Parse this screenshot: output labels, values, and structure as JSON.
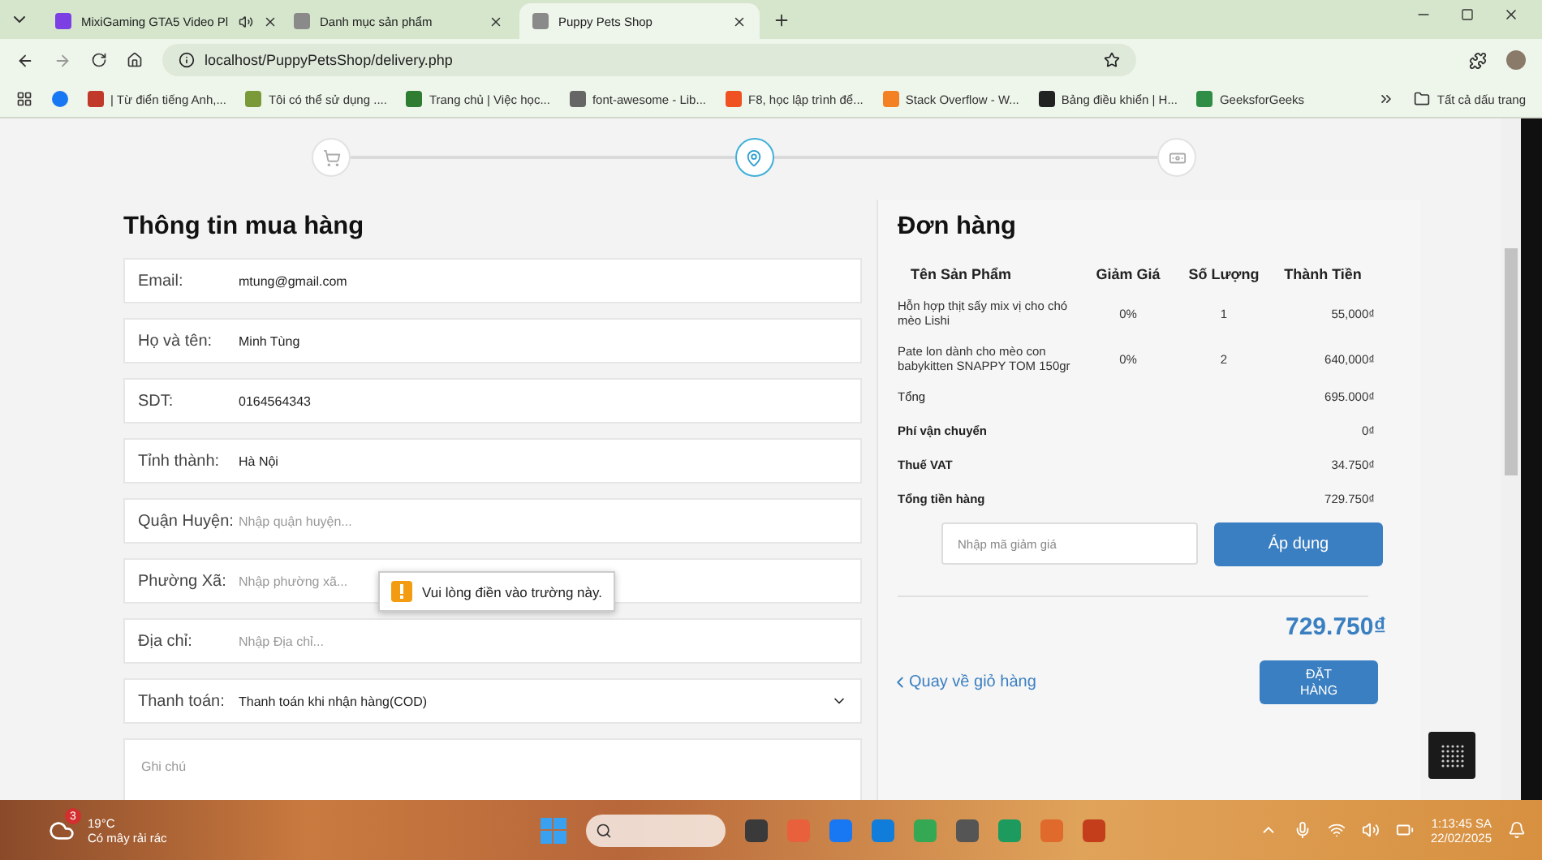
{
  "browser": {
    "tabs": [
      {
        "title": "MixiGaming GTA5 Video Pl",
        "selected": false,
        "audio": true
      },
      {
        "title": "Danh mục sản phẩm",
        "selected": false,
        "audio": false
      },
      {
        "title": "Puppy Pets Shop",
        "selected": true,
        "audio": false
      }
    ],
    "address": "localhost/PuppyPetsShop/delivery.php",
    "bookmarks": [
      {
        "color": "#1877f2"
      },
      {
        "label": "| Từ điển tiếng Anh,...",
        "color": "#c0392b"
      },
      {
        "label": "Tôi có thể sử dụng ....",
        "color": "#7a9a3a"
      },
      {
        "label": "Trang chủ | Việc học...",
        "color": "#2e7d32"
      },
      {
        "label": "font-awesome - Lib...",
        "color": "#666666"
      },
      {
        "label": "F8, học lập trình để...",
        "color": "#f05123"
      },
      {
        "label": "Stack Overflow - W...",
        "color": "#f48024"
      },
      {
        "label": "Bảng điều khiển | H...",
        "color": "#222222"
      },
      {
        "label": "GeeksforGeeks",
        "color": "#2f8d46"
      }
    ],
    "all_bookmarks": "Tất cả dấu trang"
  },
  "stepper": {
    "steps": [
      {
        "selected": false
      },
      {
        "selected": true
      },
      {
        "selected": false
      }
    ]
  },
  "form": {
    "title": "Thông tin mua hàng",
    "fields": [
      {
        "kind": "text",
        "label": "Email:",
        "value": "mtung@gmail.com"
      },
      {
        "kind": "text",
        "label": "Họ và tên:",
        "value": "Minh Tùng"
      },
      {
        "kind": "text",
        "label": "SDT:",
        "value": "0164564343"
      },
      {
        "kind": "text",
        "label": "Tỉnh thành:",
        "value": "Hà Nội"
      },
      {
        "kind": "text",
        "label": "Quận Huyện:",
        "placeholder": "Nhập quận huyện..."
      },
      {
        "kind": "text",
        "label": "Phường Xã:",
        "placeholder": "Nhập phường xã..."
      },
      {
        "kind": "text",
        "label": "Địa chỉ:",
        "placeholder": "Nhập Địa chỉ..."
      },
      {
        "kind": "select",
        "label": "Thanh toán:",
        "value": "Thanh toán khi nhận hàng(COD)"
      }
    ],
    "note": {
      "placeholder": "Ghi chú"
    },
    "tooltip": "Vui lòng điền vào trường này."
  },
  "order": {
    "title": "Đơn hàng",
    "columns": [
      "Tên Sản Phẩm",
      "Giảm Giá",
      "Số Lượng",
      "Thành Tiền"
    ],
    "rows": [
      [
        "Hỗn hợp thịt sấy mix vị cho chó mèo Lishi",
        "0%",
        "1",
        "55,000₫"
      ],
      [
        "Pate lon dành cho mèo con babykitten SNAPPY TOM 150gr",
        "0%",
        "2",
        "640,000₫"
      ]
    ],
    "summary": [
      {
        "label": "Tổng",
        "value": "695.000₫",
        "bold": false
      },
      {
        "label": "Phí vận chuyển",
        "value": "0₫",
        "bold": true
      },
      {
        "label": "Thuế VAT",
        "value": "34.750₫",
        "bold": true
      },
      {
        "label": "Tổng tiền hàng",
        "value": "729.750₫",
        "bold": true
      }
    ],
    "coupon": {
      "placeholder": "Nhập mã giảm giá"
    },
    "apply": "Áp dụng",
    "total": "729.750₫",
    "back": "Quay về giỏ hàng",
    "submit": "ĐẶT HÀNG"
  },
  "taskbar": {
    "temperature": "19°C",
    "weather": "Có mây rải rác",
    "weather_badge": "3",
    "apps": [
      {
        "color": "#3a3a3a"
      },
      {
        "color": "#e8603c"
      },
      {
        "color": "#1877f2"
      },
      {
        "color": "#0f7dd9"
      },
      {
        "color": "#34a853"
      },
      {
        "color": "#555555"
      },
      {
        "color": "#1d9b5e"
      },
      {
        "color": "#e06a2c"
      },
      {
        "color": "#c43e1c"
      }
    ],
    "time": "1:13:45 SA",
    "date": "22/02/2025"
  }
}
